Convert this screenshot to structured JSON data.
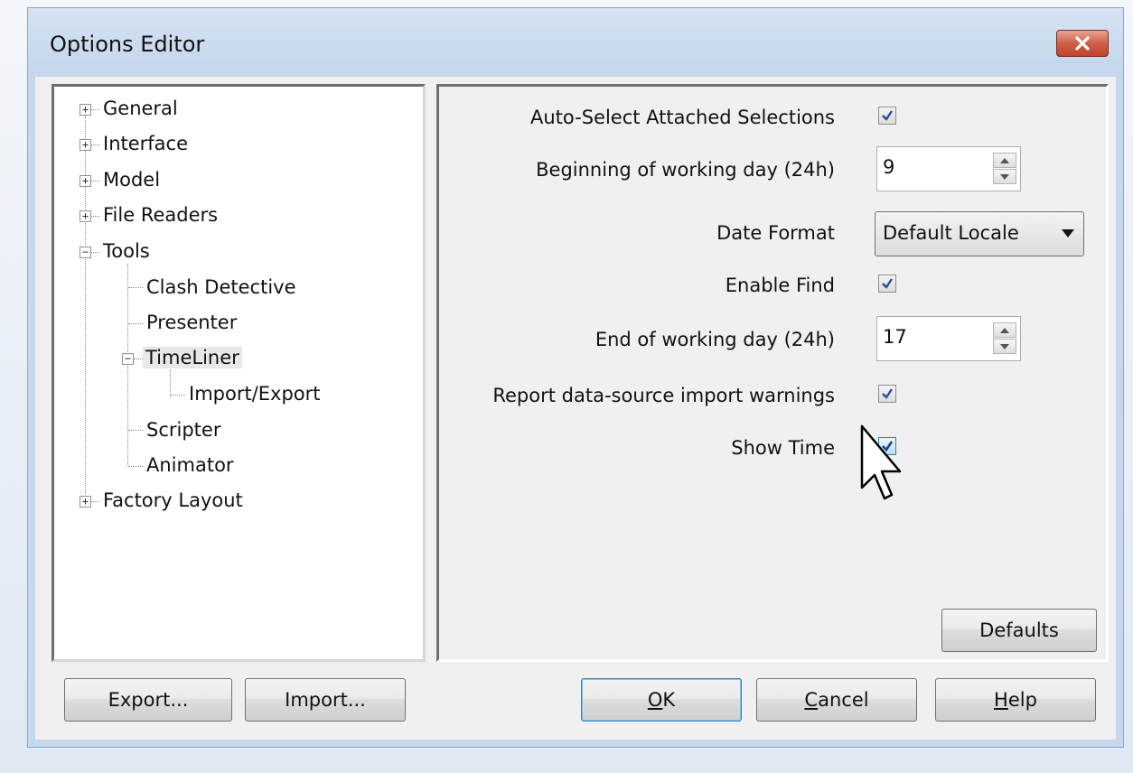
{
  "window": {
    "title": "Options Editor"
  },
  "tree": {
    "items": [
      {
        "label": "General",
        "expander": "+"
      },
      {
        "label": "Interface",
        "expander": "+"
      },
      {
        "label": "Model",
        "expander": "+"
      },
      {
        "label": "File Readers",
        "expander": "+"
      },
      {
        "label": "Tools",
        "expander": "−"
      },
      {
        "label": "Clash Detective"
      },
      {
        "label": "Presenter"
      },
      {
        "label": "TimeLiner",
        "expander": "−"
      },
      {
        "label": "Import/Export"
      },
      {
        "label": "Scripter"
      },
      {
        "label": "Animator"
      },
      {
        "label": "Factory Layout",
        "expander": "+"
      }
    ],
    "selected": "TimeLiner"
  },
  "settings": {
    "auto_select_label": "Auto-Select Attached Selections",
    "auto_select_checked": true,
    "begin_day_label": "Beginning of working day (24h)",
    "begin_day_value": "9",
    "date_format_label": "Date Format",
    "date_format_value": "Default Locale",
    "enable_find_label": "Enable Find",
    "enable_find_checked": true,
    "end_day_label": "End of working day (24h)",
    "end_day_value": "17",
    "report_warnings_label": "Report data-source import warnings",
    "report_warnings_checked": true,
    "show_time_label": "Show Time",
    "show_time_checked": true
  },
  "buttons": {
    "defaults": "Defaults",
    "export": "Export...",
    "import": "Import...",
    "ok_mnemonic": "O",
    "ok_rest": "K",
    "cancel_mnemonic": "C",
    "cancel_rest": "ancel",
    "help_mnemonic": "H",
    "help_rest": "elp"
  },
  "colors": {
    "close_button": "#c0432c",
    "title_bar": "#c4d6ec",
    "check_mark": "#2a4d8f"
  }
}
